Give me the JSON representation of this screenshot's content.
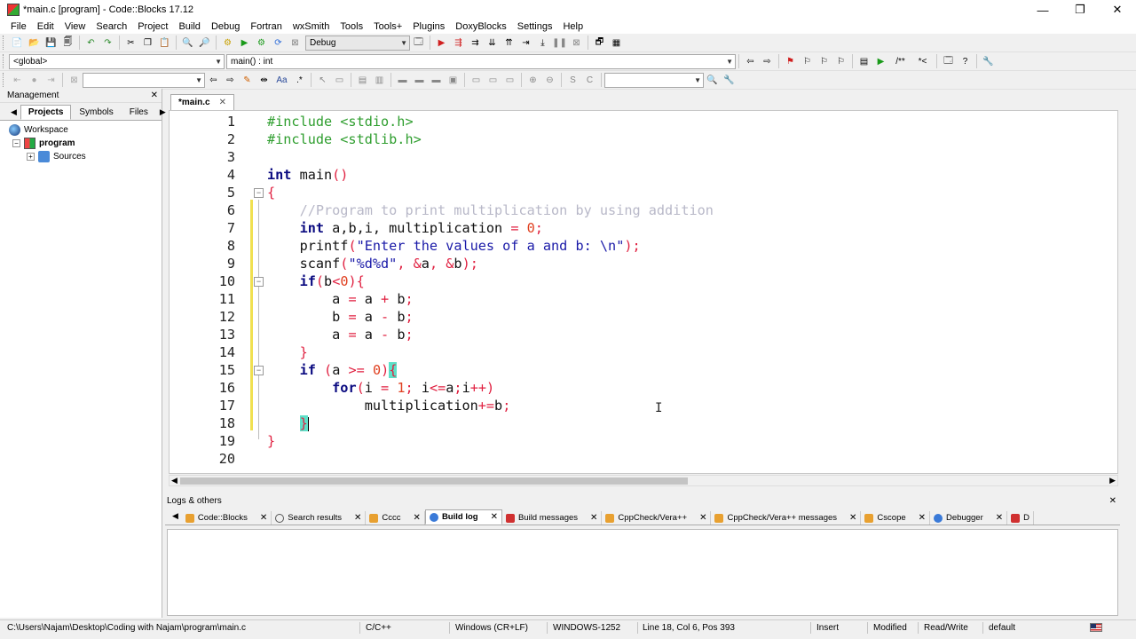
{
  "window": {
    "title": "*main.c [program] - Code::Blocks 17.12",
    "min": "—",
    "max": "❐",
    "close": "✕"
  },
  "menu": [
    "File",
    "Edit",
    "View",
    "Search",
    "Project",
    "Build",
    "Debug",
    "Fortran",
    "wxSmith",
    "Tools",
    "Tools+",
    "Plugins",
    "DoxyBlocks",
    "Settings",
    "Help"
  ],
  "toolbar": {
    "build_target": "Debug",
    "scope": "<global>",
    "function": "main() : int"
  },
  "management": {
    "title": "Management",
    "tabs": [
      "Projects",
      "Symbols",
      "Files"
    ],
    "active_tab": "Projects",
    "tree": {
      "workspace": "Workspace",
      "project": "program",
      "sources": "Sources"
    }
  },
  "editor": {
    "tab_label": "*main.c",
    "line_numbers": [
      "1",
      "2",
      "3",
      "4",
      "5",
      "6",
      "7",
      "8",
      "9",
      "10",
      "11",
      "12",
      "13",
      "14",
      "15",
      "16",
      "17",
      "18",
      "19",
      "20"
    ]
  },
  "logs": {
    "title": "Logs & others",
    "tabs": [
      "Code::Blocks",
      "Search results",
      "Cccc",
      "Build log",
      "Build messages",
      "CppCheck/Vera++",
      "CppCheck/Vera++ messages",
      "Cscope",
      "Debugger",
      "D"
    ],
    "active_tab": "Build log"
  },
  "status": {
    "path": "C:\\Users\\Najam\\Desktop\\Coding with Najam\\program\\main.c",
    "language": "C/C++",
    "eol": "Windows (CR+LF)",
    "encoding": "WINDOWS-1252",
    "position": "Line 18, Col 6, Pos 393",
    "insert": "Insert",
    "modified": "Modified",
    "rw": "Read/Write",
    "profile": "default"
  },
  "colors": {
    "preprocessor": "#2f9e2f",
    "keyword": "#0a0a80",
    "comment": "#b8b8c8",
    "string": "#1a1aa8",
    "number": "#e04020",
    "brace_highlight": "#5de0c8",
    "changed_line": "#f0e050"
  }
}
